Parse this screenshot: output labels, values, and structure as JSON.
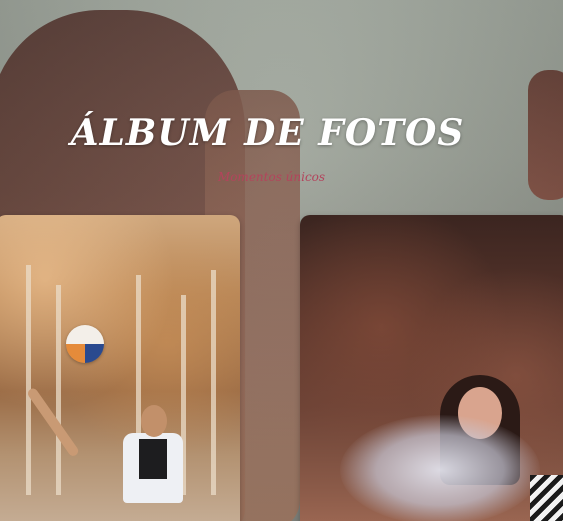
{
  "header": {
    "title": "ÁLBUM DE FOTOS",
    "subtitle": "Momentos únicos"
  },
  "gallery": {
    "photos": [
      {
        "alt": ""
      },
      {
        "alt": ""
      }
    ]
  },
  "colors": {
    "title_color": "#ffffff",
    "subtitle_color": "#b3445c"
  }
}
